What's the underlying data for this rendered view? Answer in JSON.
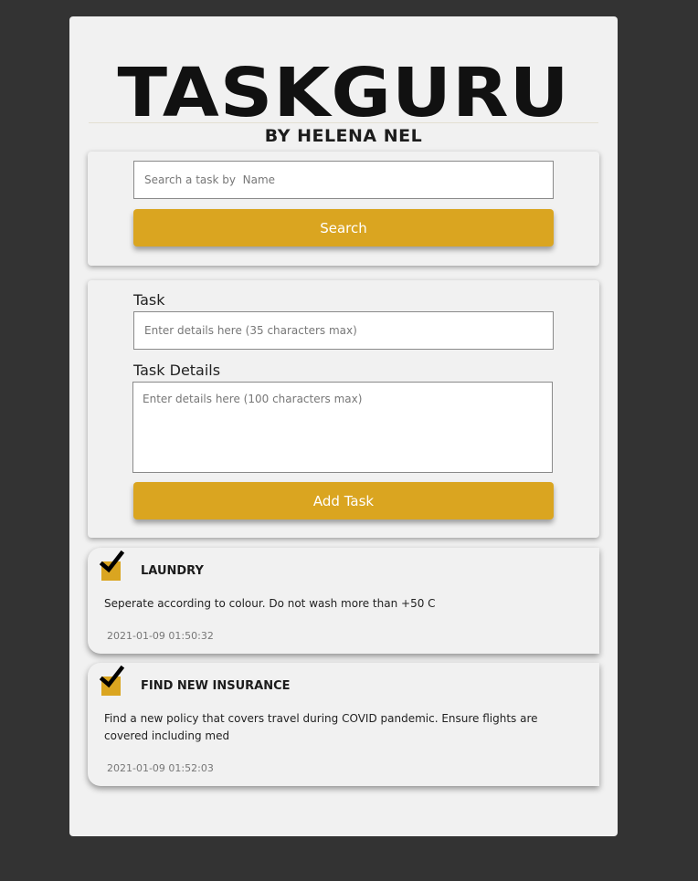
{
  "header": {
    "title": "TASKGURU",
    "subtitle": "BY HELENA NEL"
  },
  "search": {
    "placeholder": "Search a task by  Name",
    "button_label": "Search"
  },
  "form": {
    "task_label": "Task",
    "task_placeholder": "Enter details here (35 characters max)",
    "details_label": "Task Details",
    "details_placeholder": "Enter details here (100 characters max)",
    "add_button_label": "Add Task"
  },
  "tasks": [
    {
      "name": "LAUNDRY",
      "details": "Seperate according to colour. Do not wash more than +50 C",
      "timestamp": "2021-01-09 01:50:32",
      "completed": true
    },
    {
      "name": "FIND NEW INSURANCE",
      "details": "Find a new policy that covers travel during COVID pandemic. Ensure flights are covered including med",
      "timestamp": "2021-01-09 01:52:03",
      "completed": true
    }
  ],
  "colors": {
    "accent": "#daa520",
    "page_background": "#333333",
    "panel_background": "#f1f1f1"
  },
  "icons": {
    "checkmark": "check-icon"
  }
}
